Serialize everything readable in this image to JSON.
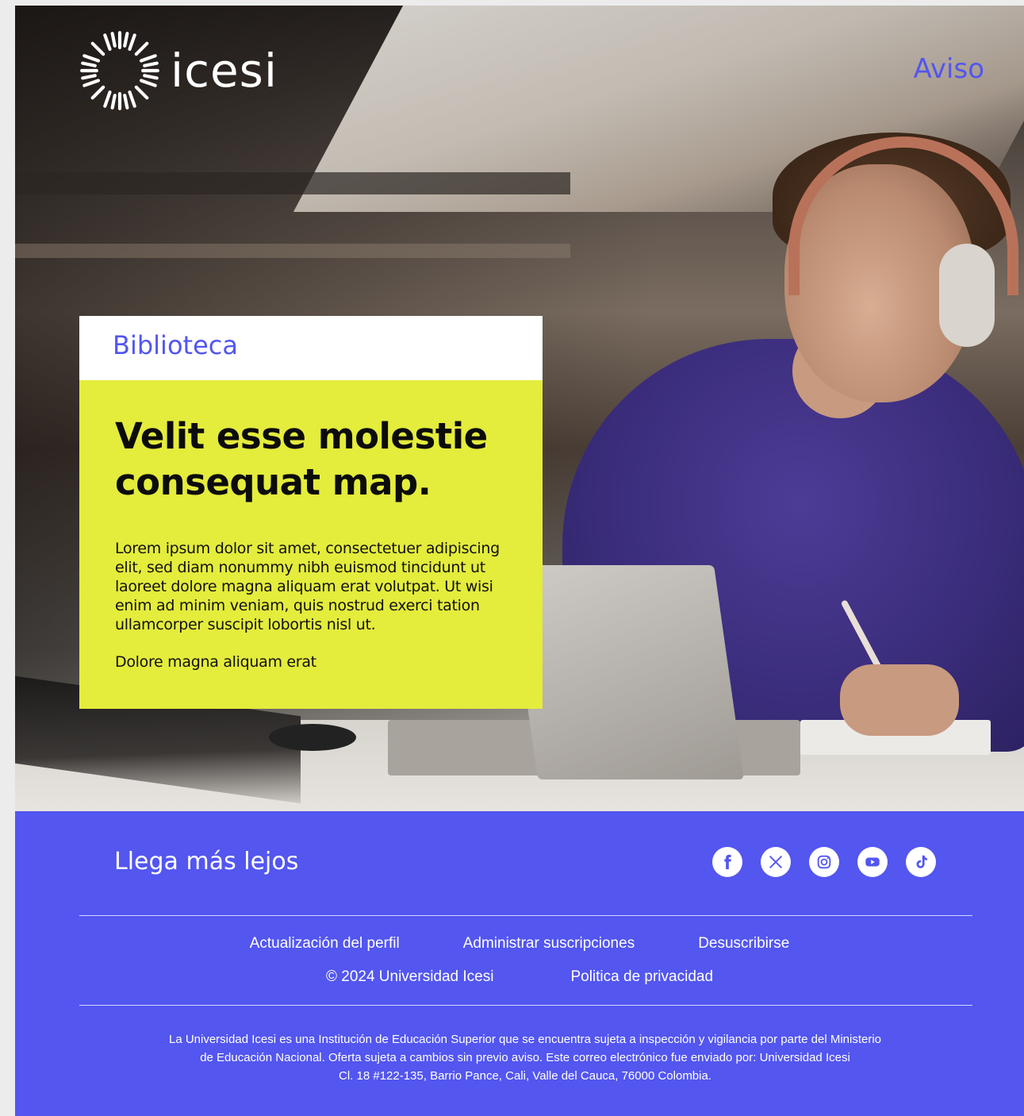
{
  "header": {
    "logo_text": "Icesi",
    "aviso_label": "Aviso"
  },
  "card": {
    "tag": "Biblioteca",
    "title": "Velit esse molestie consequat map.",
    "body": "Lorem ipsum dolor sit amet, consectetuer adipiscing elit, sed diam nonummy nibh euismod tincidunt ut laoreet dolore magna aliquam erat volutpat. Ut wisi enim ad minim veniam, quis nostrud exerci tation ullamcorper suscipit lobortis nisl ut.",
    "body2": "Dolore magna aliquam erat"
  },
  "footer": {
    "tagline": "Llega más lejos",
    "social": [
      {
        "name": "facebook-icon"
      },
      {
        "name": "x-icon"
      },
      {
        "name": "instagram-icon"
      },
      {
        "name": "youtube-icon"
      },
      {
        "name": "tiktok-icon"
      }
    ],
    "links": {
      "profile_update": "Actualización del perfil",
      "manage_subscriptions": "Administrar suscripciones",
      "unsubscribe": "Desuscribirse",
      "copyright": "© 2024 Universidad Icesi",
      "privacy": "Politica de privacidad"
    },
    "legal": {
      "line1": "La Universidad Icesi es una Institución de Educación Superior que se encuentra sujeta a inspección y vigilancia por parte del Ministerio",
      "line2": "de Educación Nacional. Oferta sujeta a cambios sin previo aviso. Este correo electrónico fue enviado por: Universidad Icesi",
      "line3": "Cl. 18 #122-135, Barrio Pance, Cali, Valle del Cauca, 76000 Colombia."
    }
  },
  "colors": {
    "brand_purple": "#5356ef",
    "highlight_yellow": "#e4ec3c"
  }
}
